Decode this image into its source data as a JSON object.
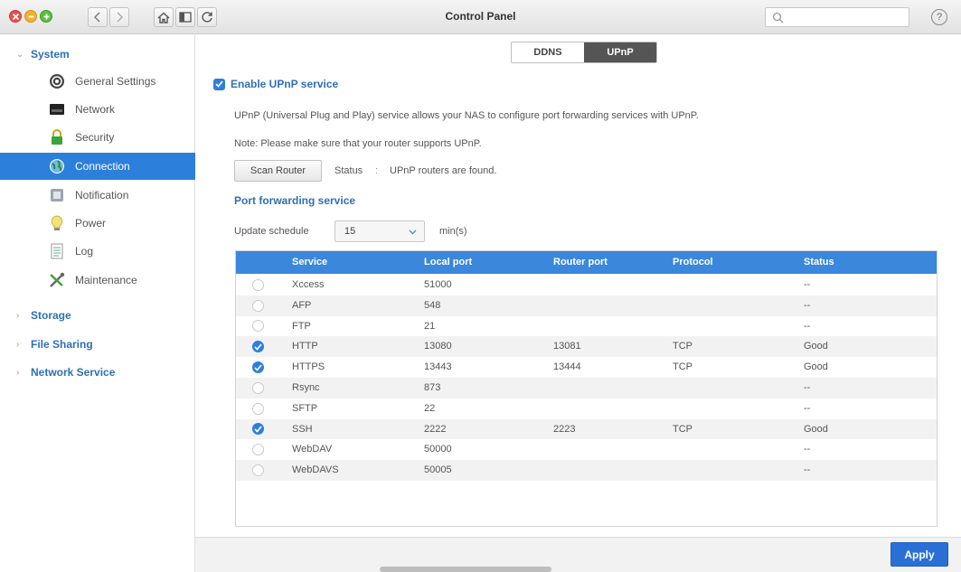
{
  "window": {
    "title": "Control Panel",
    "help_glyph": "?"
  },
  "toolbar": {
    "back_icon": "chevron-left-icon",
    "forward_icon": "chevron-right-icon",
    "home_icon": "home-icon",
    "panel_icon": "panel-icon",
    "refresh_icon": "refresh-icon"
  },
  "sidebar": {
    "groups": [
      {
        "label": "System",
        "expanded": true
      },
      {
        "label": "Storage",
        "expanded": false
      },
      {
        "label": "File Sharing",
        "expanded": false
      },
      {
        "label": "Network Service",
        "expanded": false
      }
    ],
    "items": [
      {
        "label": "General Settings",
        "icon": "general-settings-icon"
      },
      {
        "label": "Network",
        "icon": "network-icon"
      },
      {
        "label": "Security",
        "icon": "lock-icon"
      },
      {
        "label": "Connection",
        "icon": "globe-icon",
        "active": true
      },
      {
        "label": "Notification",
        "icon": "notification-icon"
      },
      {
        "label": "Power",
        "icon": "lightbulb-icon"
      },
      {
        "label": "Log",
        "icon": "log-icon"
      },
      {
        "label": "Maintenance",
        "icon": "tools-icon"
      }
    ]
  },
  "tabs": [
    {
      "label": "DDNS",
      "active": false
    },
    {
      "label": "UPnP",
      "active": true
    }
  ],
  "upnp": {
    "enable_label": "Enable UPnP service",
    "enabled": true,
    "description": "UPnP (Universal Plug and Play) service allows your NAS to configure port forwarding services with UPnP.",
    "note": "Note: Please make sure that your router supports UPnP.",
    "scan_button": "Scan Router",
    "status_label": "Status",
    "status_separator": ":",
    "status_value": "UPnP routers are found."
  },
  "port_forwarding": {
    "title": "Port forwarding service",
    "schedule_label": "Update schedule",
    "schedule_value": "15",
    "schedule_unit": "min(s)",
    "columns": [
      "Service",
      "Local port",
      "Router port",
      "Protocol",
      "Status"
    ],
    "rows": [
      {
        "checked": false,
        "service": "Xccess",
        "local_port": "51000",
        "router_port": "",
        "protocol": "",
        "status": "--"
      },
      {
        "checked": false,
        "service": "AFP",
        "local_port": "548",
        "router_port": "",
        "protocol": "",
        "status": "--"
      },
      {
        "checked": false,
        "service": "FTP",
        "local_port": "21",
        "router_port": "",
        "protocol": "",
        "status": "--"
      },
      {
        "checked": true,
        "service": "HTTP",
        "local_port": "13080",
        "router_port": "13081",
        "protocol": "TCP",
        "status": "Good"
      },
      {
        "checked": true,
        "service": "HTTPS",
        "local_port": "13443",
        "router_port": "13444",
        "protocol": "TCP",
        "status": "Good"
      },
      {
        "checked": false,
        "service": "Rsync",
        "local_port": "873",
        "router_port": "",
        "protocol": "",
        "status": "--"
      },
      {
        "checked": false,
        "service": "SFTP",
        "local_port": "22",
        "router_port": "",
        "protocol": "",
        "status": "--"
      },
      {
        "checked": true,
        "service": "SSH",
        "local_port": "2222",
        "router_port": "2223",
        "protocol": "TCP",
        "status": "Good"
      },
      {
        "checked": false,
        "service": "WebDAV",
        "local_port": "50000",
        "router_port": "",
        "protocol": "",
        "status": "--"
      },
      {
        "checked": false,
        "service": "WebDAVS",
        "local_port": "50005",
        "router_port": "",
        "protocol": "",
        "status": "--"
      }
    ]
  },
  "footer": {
    "apply_button": "Apply"
  },
  "colors": {
    "accent": "#2d7fdc",
    "header": "#3a87dc",
    "link": "#2f6fb5",
    "apply": "#2a6fd6"
  }
}
